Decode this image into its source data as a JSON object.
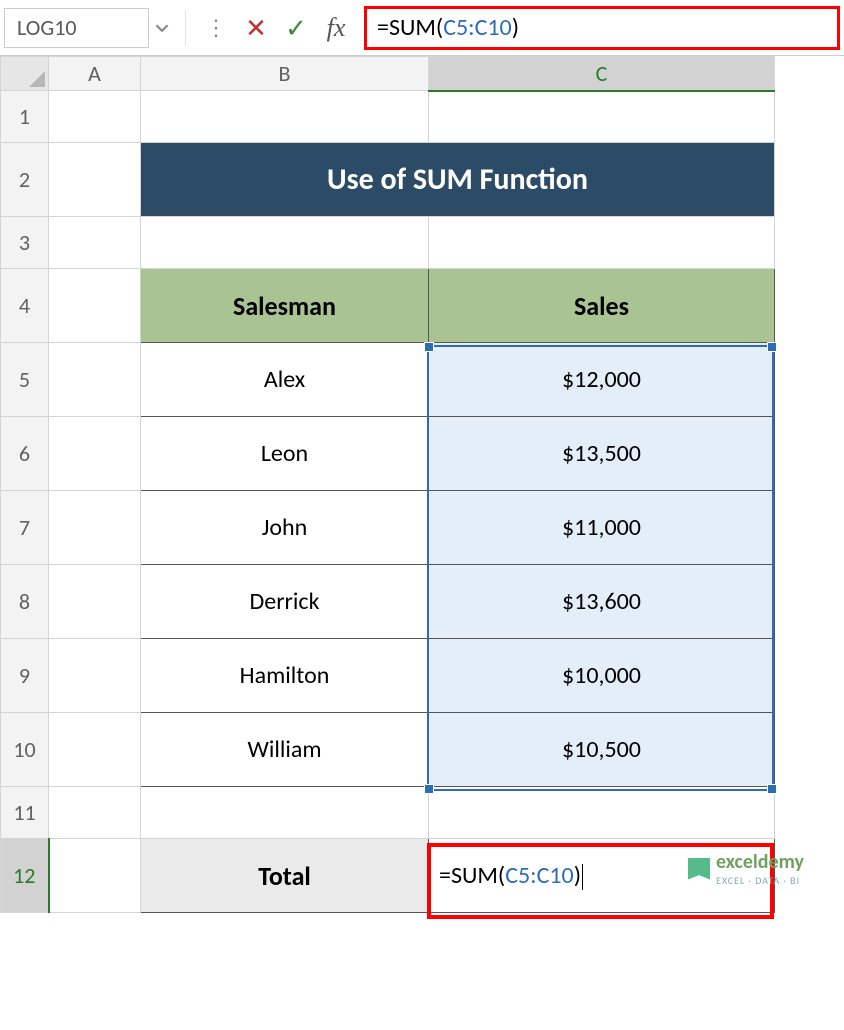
{
  "name_box": "LOG10",
  "formula_bar": {
    "prefix": "=SUM(",
    "ref": "C5:C10",
    "suffix": ")"
  },
  "columns": {
    "A": "A",
    "B": "B",
    "C": "C"
  },
  "rows": [
    "1",
    "2",
    "3",
    "4",
    "5",
    "6",
    "7",
    "8",
    "9",
    "10",
    "11",
    "12"
  ],
  "title": "Use of SUM Function",
  "headers": {
    "salesman": "Salesman",
    "sales": "Sales"
  },
  "data": [
    {
      "name": "Alex",
      "sales": "$12,000"
    },
    {
      "name": "Leon",
      "sales": "$13,500"
    },
    {
      "name": "John",
      "sales": "$11,000"
    },
    {
      "name": "Derrick",
      "sales": "$13,600"
    },
    {
      "name": "Hamilton",
      "sales": "$10,000"
    },
    {
      "name": "William",
      "sales": "$10,500"
    }
  ],
  "total_label": "Total",
  "total_formula": {
    "prefix": "=SUM(",
    "ref": "C5:C10",
    "suffix": ")"
  },
  "watermark": {
    "brand": "exceldemy",
    "tag": "EXCEL · DATA · BI"
  }
}
